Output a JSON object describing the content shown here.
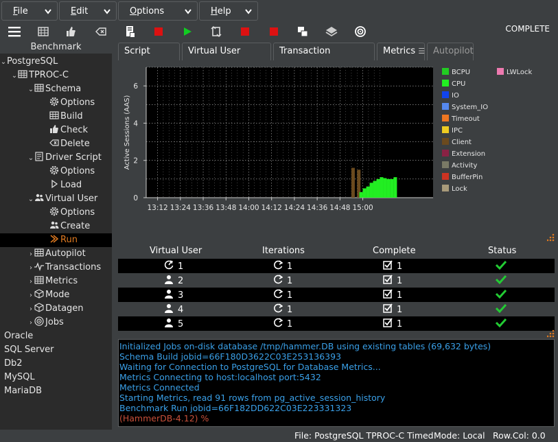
{
  "menus": [
    {
      "label": "File"
    },
    {
      "label": "Edit"
    },
    {
      "label": "Options"
    },
    {
      "label": "Help"
    }
  ],
  "toolbar": {
    "status_text": "COMPLETE",
    "icons": [
      "menu-icon",
      "database-icon",
      "thumbs-up-icon",
      "eraser-icon",
      "script-icon",
      "stop-icon",
      "play-icon",
      "refresh-icon",
      "stop-icon",
      "stop-icon",
      "windows-icon",
      "stack-icon",
      "target-icon"
    ]
  },
  "tree": {
    "header": "Benchmark",
    "nodes": [
      {
        "label": "PostgreSQL",
        "icon": "",
        "arrow": "v"
      },
      {
        "label": "TPROC-C",
        "icon": "grid-icon",
        "arrow": "v"
      },
      {
        "label": "Schema",
        "icon": "grid-icon",
        "arrow": "v"
      },
      {
        "label": "Options",
        "icon": "gear-icon",
        "arrow": ""
      },
      {
        "label": "Build",
        "icon": "grid-icon",
        "arrow": ""
      },
      {
        "label": "Check",
        "icon": "thumbs-up-icon",
        "arrow": ""
      },
      {
        "label": "Delete",
        "icon": "eraser-icon",
        "arrow": ""
      },
      {
        "label": "Driver Script",
        "icon": "script-icon",
        "arrow": "v"
      },
      {
        "label": "Options",
        "icon": "gear-icon",
        "arrow": ""
      },
      {
        "label": "Load",
        "icon": "triangle-icon",
        "arrow": ""
      },
      {
        "label": "Virtual User",
        "icon": "users-icon",
        "arrow": "v"
      },
      {
        "label": "Options",
        "icon": "gear-icon",
        "arrow": ""
      },
      {
        "label": "Create",
        "icon": "users-icon",
        "arrow": ""
      },
      {
        "label": "Run",
        "icon": "run-icon",
        "arrow": ""
      },
      {
        "label": "Autopilot",
        "icon": "grid-icon",
        "arrow": ">"
      },
      {
        "label": "Transactions",
        "icon": "pulse-icon",
        "arrow": ">"
      },
      {
        "label": "Metrics",
        "icon": "grid-icon",
        "arrow": ">"
      },
      {
        "label": "Mode",
        "icon": "cube-icon",
        "arrow": ">"
      },
      {
        "label": "Datagen",
        "icon": "cube-icon",
        "arrow": ">"
      },
      {
        "label": "Jobs",
        "icon": "target-icon",
        "arrow": ">"
      },
      {
        "label": "Oracle",
        "icon": "",
        "arrow": ""
      },
      {
        "label": "SQL Server",
        "icon": "",
        "arrow": ""
      },
      {
        "label": "Db2",
        "icon": "",
        "arrow": ""
      },
      {
        "label": "MySQL",
        "icon": "",
        "arrow": ""
      },
      {
        "label": "MariaDB",
        "icon": "",
        "arrow": ""
      }
    ]
  },
  "tabs": [
    {
      "label": "Script Editor"
    },
    {
      "label": "Virtual User Output"
    },
    {
      "label": "Transaction Counter"
    },
    {
      "label": "Metrics"
    },
    {
      "label": "Autopilot"
    }
  ],
  "chart_data": {
    "type": "area",
    "title": "",
    "ylabel": "Active Sessions (AAS)",
    "xlabel": "",
    "x_ticks": [
      "13:12",
      "13:24",
      "13:36",
      "13:48",
      "14:00",
      "14:12",
      "14:24",
      "14:36",
      "14:48",
      "15:00"
    ],
    "y_ticks": [
      0,
      2,
      4,
      6
    ],
    "ylim": [
      0,
      7
    ],
    "grid": true,
    "legend_position": "right",
    "legend": [
      {
        "name": "BCPU",
        "color": "#22cc22"
      },
      {
        "name": "LWLock",
        "color": "#ee7ab0"
      },
      {
        "name": "CPU",
        "color": "#22ee22"
      },
      {
        "name": "IO",
        "color": "#1144ee"
      },
      {
        "name": "System_IO",
        "color": "#5588ee"
      },
      {
        "name": "Timeout",
        "color": "#ee7722"
      },
      {
        "name": "IPC",
        "color": "#eecc22"
      },
      {
        "name": "Client",
        "color": "#6b4a1e"
      },
      {
        "name": "Extension",
        "color": "#8a2244"
      },
      {
        "name": "Activity",
        "color": "#7a7a66"
      },
      {
        "name": "BufferPin",
        "color": "#cc3322"
      },
      {
        "name": "Lock",
        "color": "#a89a7a"
      }
    ],
    "series": [
      {
        "name": "Client",
        "color": "#6b4a1e",
        "x": [
          14.9,
          14.95
        ],
        "values": [
          1.6,
          1.5
        ]
      },
      {
        "name": "CPU",
        "color": "#22ee22",
        "x": [
          14.97,
          15.0,
          15.03,
          15.06,
          15.09,
          15.12,
          15.15,
          15.18,
          15.21,
          15.24,
          15.27
        ],
        "values": [
          0.3,
          0.5,
          0.6,
          0.8,
          0.9,
          1.0,
          1.1,
          1.05,
          1.0,
          1.0,
          1.1
        ]
      }
    ]
  },
  "sessions": {
    "headers": [
      "Virtual User",
      "Iterations",
      "Complete",
      "Status"
    ],
    "rows": [
      {
        "user": "1",
        "iterations": "1",
        "complete": "1",
        "user_icon": "monitor-icon"
      },
      {
        "user": "2",
        "iterations": "1",
        "complete": "1",
        "user_icon": "user-icon"
      },
      {
        "user": "3",
        "iterations": "1",
        "complete": "1",
        "user_icon": "user-icon"
      },
      {
        "user": "4",
        "iterations": "1",
        "complete": "1",
        "user_icon": "user-icon"
      },
      {
        "user": "5",
        "iterations": "1",
        "complete": "1",
        "user_icon": "user-icon"
      }
    ]
  },
  "console": {
    "lines": [
      "Initialized Jobs on-disk database /tmp/hammer.DB using existing tables (69,632 bytes)",
      "Schema Build jobid=66F180D3622C03E253136393",
      "Waiting for Connection to PostgreSQL for Database Metrics...",
      "Metrics Connecting to host:localhost port:5432",
      "Metrics Connected",
      "Starting Metrics, read 91 rows from pg_active_session_history",
      "Benchmark Run jobid=66F182DD622C03E223331323"
    ],
    "prompt": "(HammerDB-4.12) %"
  },
  "statusbar": {
    "file": "File: PostgreSQL TPROC-C Timed",
    "mode": "Mode: Local",
    "rowcol": "Row.Col:  0.0"
  }
}
